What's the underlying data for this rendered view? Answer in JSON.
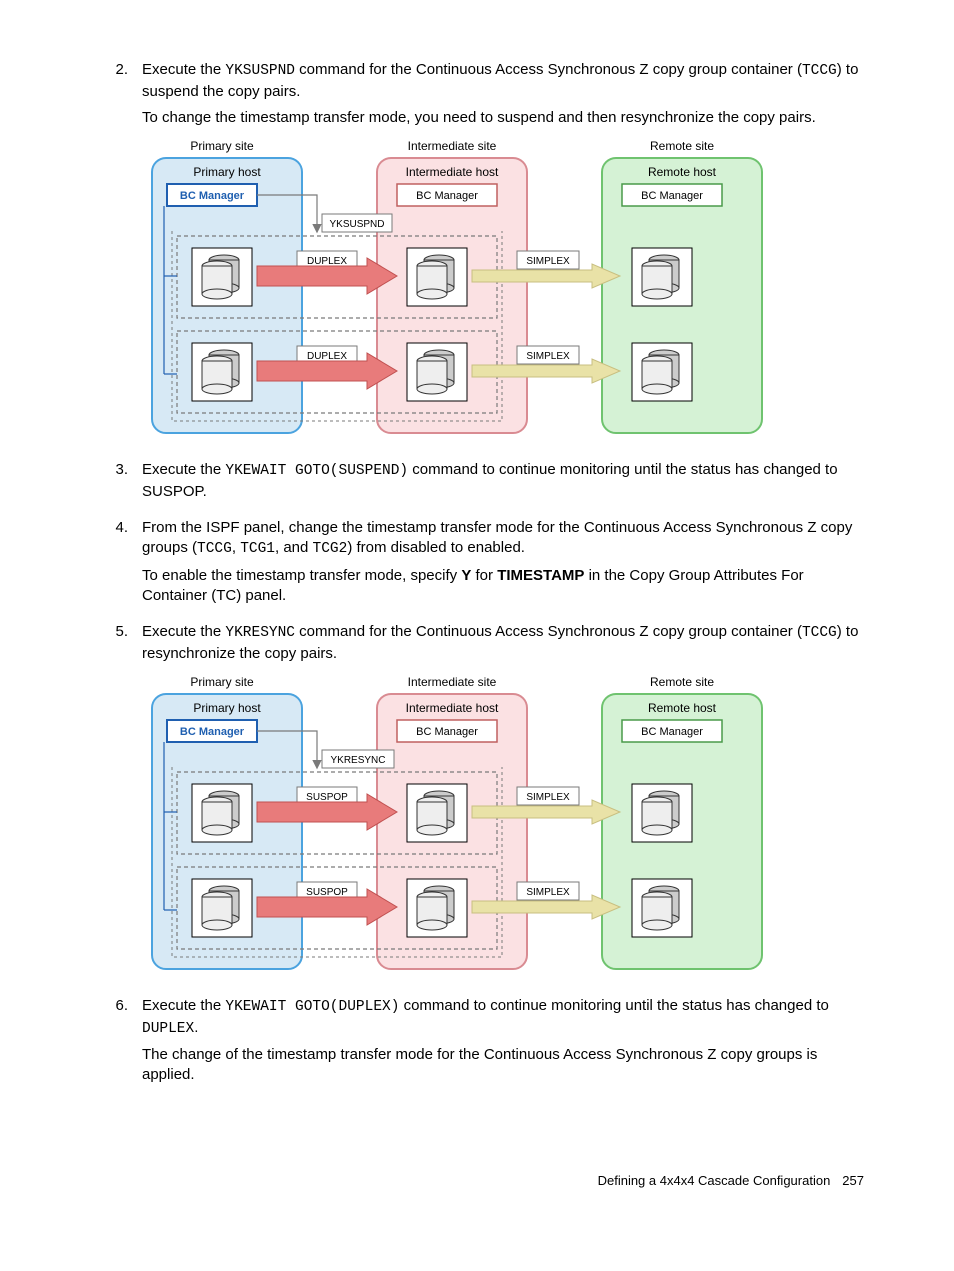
{
  "steps": {
    "s2": {
      "num": "2.",
      "p1a": "Execute the ",
      "p1cmd": "YKSUSPND",
      "p1b": " command for the Continuous Access Synchronous Z copy group container (",
      "p1cmd2": "TCCG",
      "p1c": ") to suspend the copy pairs.",
      "p2": "To change the timestamp transfer mode, you need to suspend and then resynchronize the copy pairs."
    },
    "s3": {
      "num": "3.",
      "p1a": "Execute the ",
      "p1cmd": "YKEWAIT GOTO(SUSPEND)",
      "p1b": " command to continue monitoring until the status has changed to SUSPOP."
    },
    "s4": {
      "num": "4.",
      "p1a": "From the ISPF panel, change the timestamp transfer mode for the Continuous Access Synchronous Z copy groups (",
      "p1cmd1": "TCCG",
      "p1sep1": ", ",
      "p1cmd2": "TCG1",
      "p1sep2": ", and ",
      "p1cmd3": "TCG2",
      "p1b": ") from disabled to enabled.",
      "p2a": "To enable the timestamp transfer mode, specify ",
      "p2y": "Y",
      "p2b": " for ",
      "p2ts": "TIMESTAMP",
      "p2c": " in the Copy Group Attributes For Container (TC) panel."
    },
    "s5": {
      "num": "5.",
      "p1a": "Execute the ",
      "p1cmd": "YKRESYNC",
      "p1b": " command for the Continuous Access Synchronous Z copy group container (",
      "p1cmd2": "TCCG",
      "p1c": ") to resynchronize the copy pairs."
    },
    "s6": {
      "num": "6.",
      "p1a": "Execute the ",
      "p1cmd": "YKEWAIT GOTO(DUPLEX)",
      "p1b": " command to continue monitoring until the status has changed to ",
      "p1cmd2": "DUPLEX",
      "p1c": ".",
      "p2": "The change of the timestamp transfer mode for the Continuous Access Synchronous Z copy groups is applied."
    }
  },
  "diagram1": {
    "primarySite": "Primary site",
    "primaryHost": "Primary host",
    "intermediateSite": "Intermediate site",
    "intermediateHost": "Intermediate host",
    "remoteSite": "Remote site",
    "remoteHost": "Remote host",
    "bcManager": "BC Manager",
    "cmd": "YKSUSPND",
    "state12": "DUPLEX",
    "state23": "SIMPLEX"
  },
  "diagram2": {
    "primarySite": "Primary site",
    "primaryHost": "Primary host",
    "intermediateSite": "Intermediate site",
    "intermediateHost": "Intermediate host",
    "remoteSite": "Remote site",
    "remoteHost": "Remote host",
    "bcManager": "BC Manager",
    "cmd": "YKRESYNC",
    "state12": "SUSPOP",
    "state23": "SIMPLEX"
  },
  "footer": {
    "title": "Defining a 4x4x4 Cascade Configuration",
    "page": "257"
  },
  "colors": {
    "primaryFill": "#d7e9f5",
    "primaryStroke": "#4ba3df",
    "intermFill": "#fbe1e3",
    "intermStroke": "#d98b92",
    "remoteFill": "#d5f2d5",
    "remoteStroke": "#6fc36f",
    "bcBoxStroke": "#1f5fb0",
    "bcBoxStroke2": "#c06060",
    "bcBoxStroke3": "#4a9a4a",
    "redArrow": "#e87b7b",
    "yellowArrow": "#e9e2a7",
    "grayDash": "#7a7a7a",
    "bcBoxFill": "#ffffff"
  }
}
